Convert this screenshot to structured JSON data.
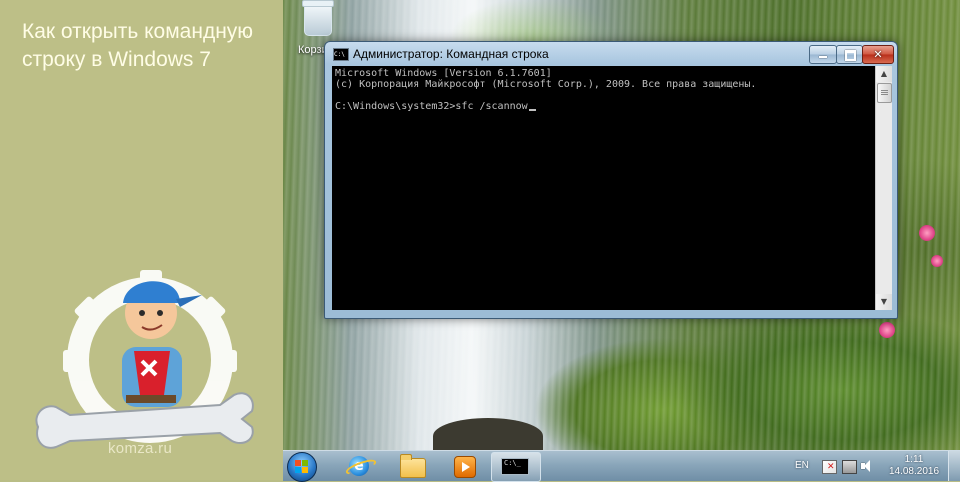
{
  "banner": {
    "title": "Как открыть командную строку в Windows 7",
    "brand": "komza.ru"
  },
  "desktop": {
    "recycle_bin_label": "Корзина"
  },
  "window": {
    "title": "Администратор: Командная строка",
    "icon_text": "C:\\",
    "console_lines": [
      "Microsoft Windows [Version 6.1.7601]",
      "(c) Корпорация Майкрософт (Microsoft Corp.), 2009. Все права защищены.",
      "",
      "C:\\Windows\\system32>sfc /scannow"
    ],
    "scroll_up": "▲",
    "scroll_down": "▼"
  },
  "taskbar": {
    "cmd_icon_text": "C:\\_",
    "language": "EN",
    "time": "1:11",
    "date": "14.08.2016"
  },
  "colors": {
    "banner_bg": "#bdbf87",
    "banner_text": "#fffde6",
    "console_bg": "#000000",
    "console_text": "#c0c0c0",
    "close_button": "#c8402c"
  }
}
